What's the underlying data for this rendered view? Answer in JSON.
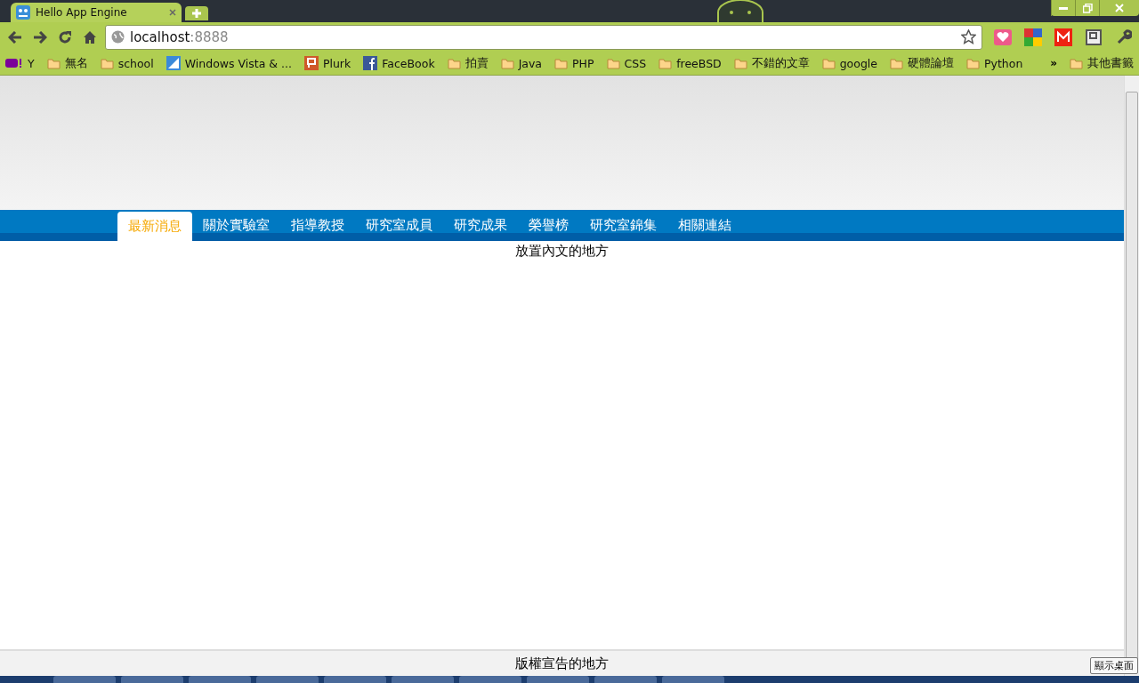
{
  "browser": {
    "tabs": [
      {
        "title": "Hello App Engine",
        "selected": true
      }
    ],
    "address": {
      "host": "localhost",
      "port": ":8888"
    },
    "bookmarks": [
      {
        "kind": "yahoo",
        "label": "Y"
      },
      {
        "kind": "folder",
        "label": "無名"
      },
      {
        "kind": "folder",
        "label": "school"
      },
      {
        "kind": "vista",
        "label": "Windows Vista & ..."
      },
      {
        "kind": "plurk",
        "label": "Plurk"
      },
      {
        "kind": "facebook",
        "label": "FaceBook"
      },
      {
        "kind": "folder",
        "label": "拍賣"
      },
      {
        "kind": "folder",
        "label": "Java"
      },
      {
        "kind": "folder",
        "label": "PHP"
      },
      {
        "kind": "folder",
        "label": "CSS"
      },
      {
        "kind": "folder",
        "label": "freeBSD"
      },
      {
        "kind": "folder",
        "label": "不錯的文章"
      },
      {
        "kind": "folder",
        "label": "google"
      },
      {
        "kind": "folder",
        "label": "硬體論壇"
      },
      {
        "kind": "folder",
        "label": "Python"
      }
    ],
    "overflow": "»",
    "other_bookmarks": "其他書籤"
  },
  "page": {
    "nav": [
      {
        "label": "最新消息",
        "selected": true
      },
      {
        "label": "關於實驗室",
        "selected": false
      },
      {
        "label": "指導教授",
        "selected": false
      },
      {
        "label": "研究室成員",
        "selected": false
      },
      {
        "label": "研究成果",
        "selected": false
      },
      {
        "label": "榮譽榜",
        "selected": false
      },
      {
        "label": "研究室錦集",
        "selected": false
      },
      {
        "label": "相關連結",
        "selected": false
      }
    ],
    "content": "放置內文的地方",
    "footer": "版權宣告的地方"
  },
  "taskbar": {
    "tooltip": "顯示桌面"
  }
}
